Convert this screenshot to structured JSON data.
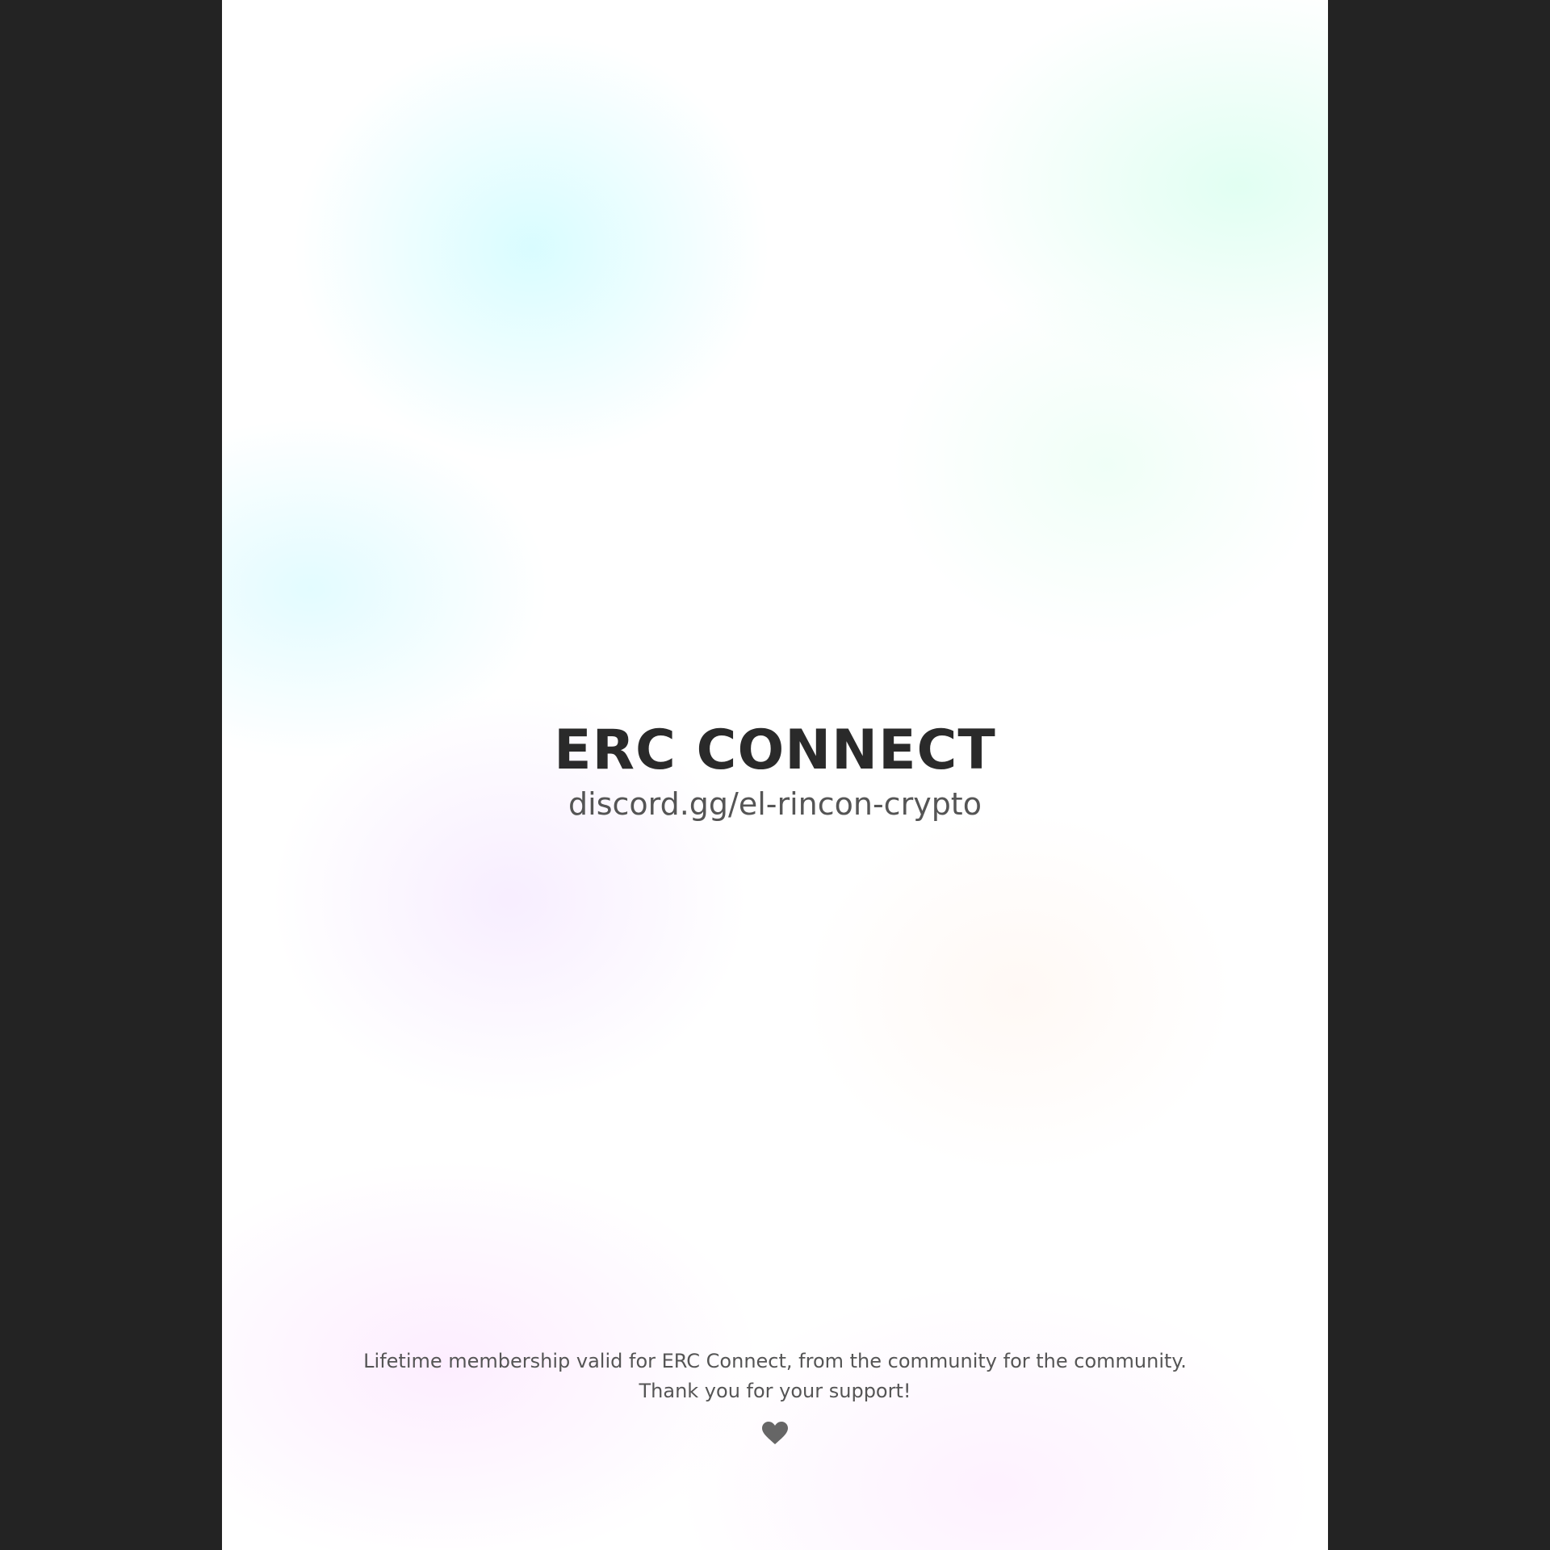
{
  "card": {
    "title": "ERC CONNECT",
    "invite": "discord.gg/el-rincon-crypto",
    "note_line1": "Lifetime membership valid for ERC Connect, from the community for the community.",
    "note_line2": "Thank you for your support!",
    "icon": "heart-icon"
  },
  "colors": {
    "background": "#232323",
    "title": "#2a2a2a",
    "text": "#555555",
    "icon": "#666666"
  }
}
